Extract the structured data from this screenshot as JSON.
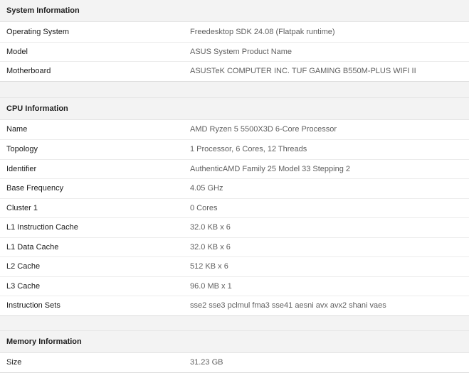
{
  "system": {
    "title": "System Information",
    "rows": [
      {
        "label": "Operating System",
        "value": "Freedesktop SDK 24.08 (Flatpak runtime)"
      },
      {
        "label": "Model",
        "value": "ASUS System Product Name"
      },
      {
        "label": "Motherboard",
        "value": "ASUSTeK COMPUTER INC. TUF GAMING B550M-PLUS WIFI II"
      }
    ]
  },
  "cpu": {
    "title": "CPU Information",
    "rows": [
      {
        "label": "Name",
        "value": "AMD Ryzen 5 5500X3D 6-Core Processor"
      },
      {
        "label": "Topology",
        "value": "1 Processor, 6 Cores, 12 Threads"
      },
      {
        "label": "Identifier",
        "value": "AuthenticAMD Family 25 Model 33 Stepping 2"
      },
      {
        "label": "Base Frequency",
        "value": "4.05 GHz"
      },
      {
        "label": "Cluster 1",
        "value": "0 Cores"
      },
      {
        "label": "L1 Instruction Cache",
        "value": "32.0 KB x 6"
      },
      {
        "label": "L1 Data Cache",
        "value": "32.0 KB x 6"
      },
      {
        "label": "L2 Cache",
        "value": "512 KB x 6"
      },
      {
        "label": "L3 Cache",
        "value": "96.0 MB x 1"
      },
      {
        "label": "Instruction Sets",
        "value": "sse2 sse3 pclmul fma3 sse41 aesni avx avx2 shani vaes"
      }
    ]
  },
  "memory": {
    "title": "Memory Information",
    "rows": [
      {
        "label": "Size",
        "value": "31.23 GB"
      }
    ]
  }
}
